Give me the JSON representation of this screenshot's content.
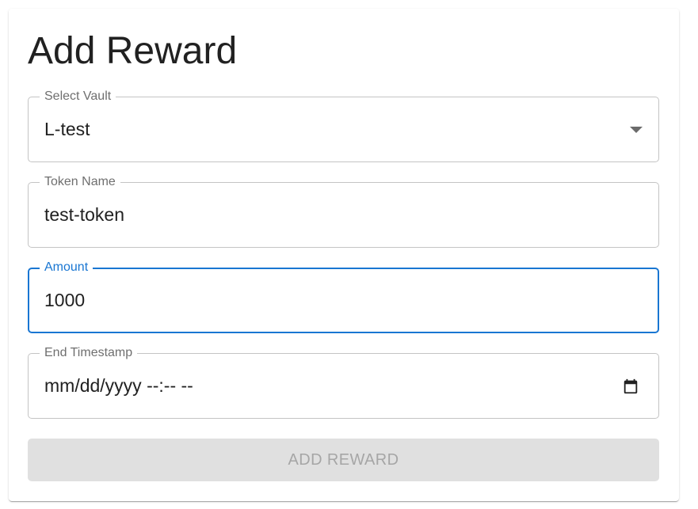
{
  "form": {
    "title": "Add Reward",
    "vault": {
      "label": "Select Vault",
      "value": "L-test",
      "icon": "dropdown-arrow-icon"
    },
    "token_name": {
      "label": "Token Name",
      "value": "test-token"
    },
    "amount": {
      "label": "Amount",
      "value": "1000",
      "state": "focused"
    },
    "end_timestamp": {
      "label": "End Timestamp",
      "value": "mm/dd/yyyy --:-- --",
      "icon": "calendar-icon"
    },
    "submit": {
      "label": "ADD REWARD",
      "state": "disabled"
    }
  },
  "colors": {
    "accent": "#1976d2",
    "border": "#c4c4c4",
    "label": "#6f6f6f",
    "text": "#212121",
    "disabled_bg": "#e0e0e0",
    "disabled_text": "#a6a6a6"
  }
}
